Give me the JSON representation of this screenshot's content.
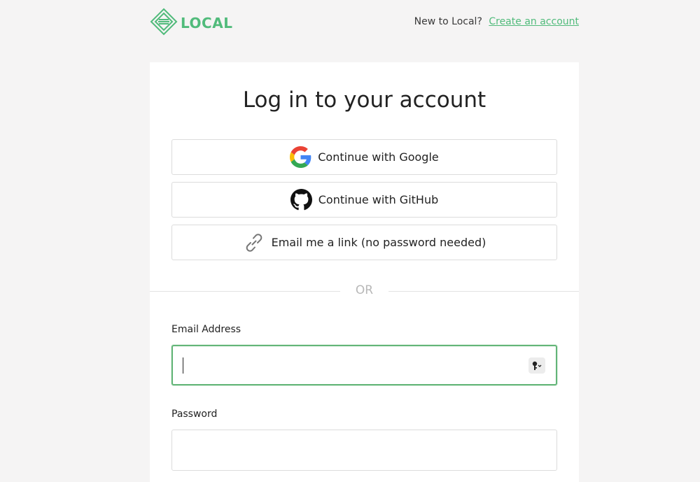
{
  "header": {
    "logo_text": "LOCAL",
    "new_user_text": "New to Local?",
    "create_account_link": "Create an account"
  },
  "login": {
    "title": "Log in to your account",
    "google_button": "Continue with Google",
    "github_button": "Continue with GitHub",
    "email_link_button": "Email me a link (no password needed)",
    "divider_text": "OR",
    "email_label": "Email Address",
    "email_value": "",
    "password_label": "Password",
    "password_value": ""
  },
  "colors": {
    "brand_green": "#51bb7b",
    "focus_border": "#63b578"
  },
  "icons": [
    "local-logo-icon",
    "google-icon",
    "github-icon",
    "link-icon",
    "password-key-icon"
  ]
}
